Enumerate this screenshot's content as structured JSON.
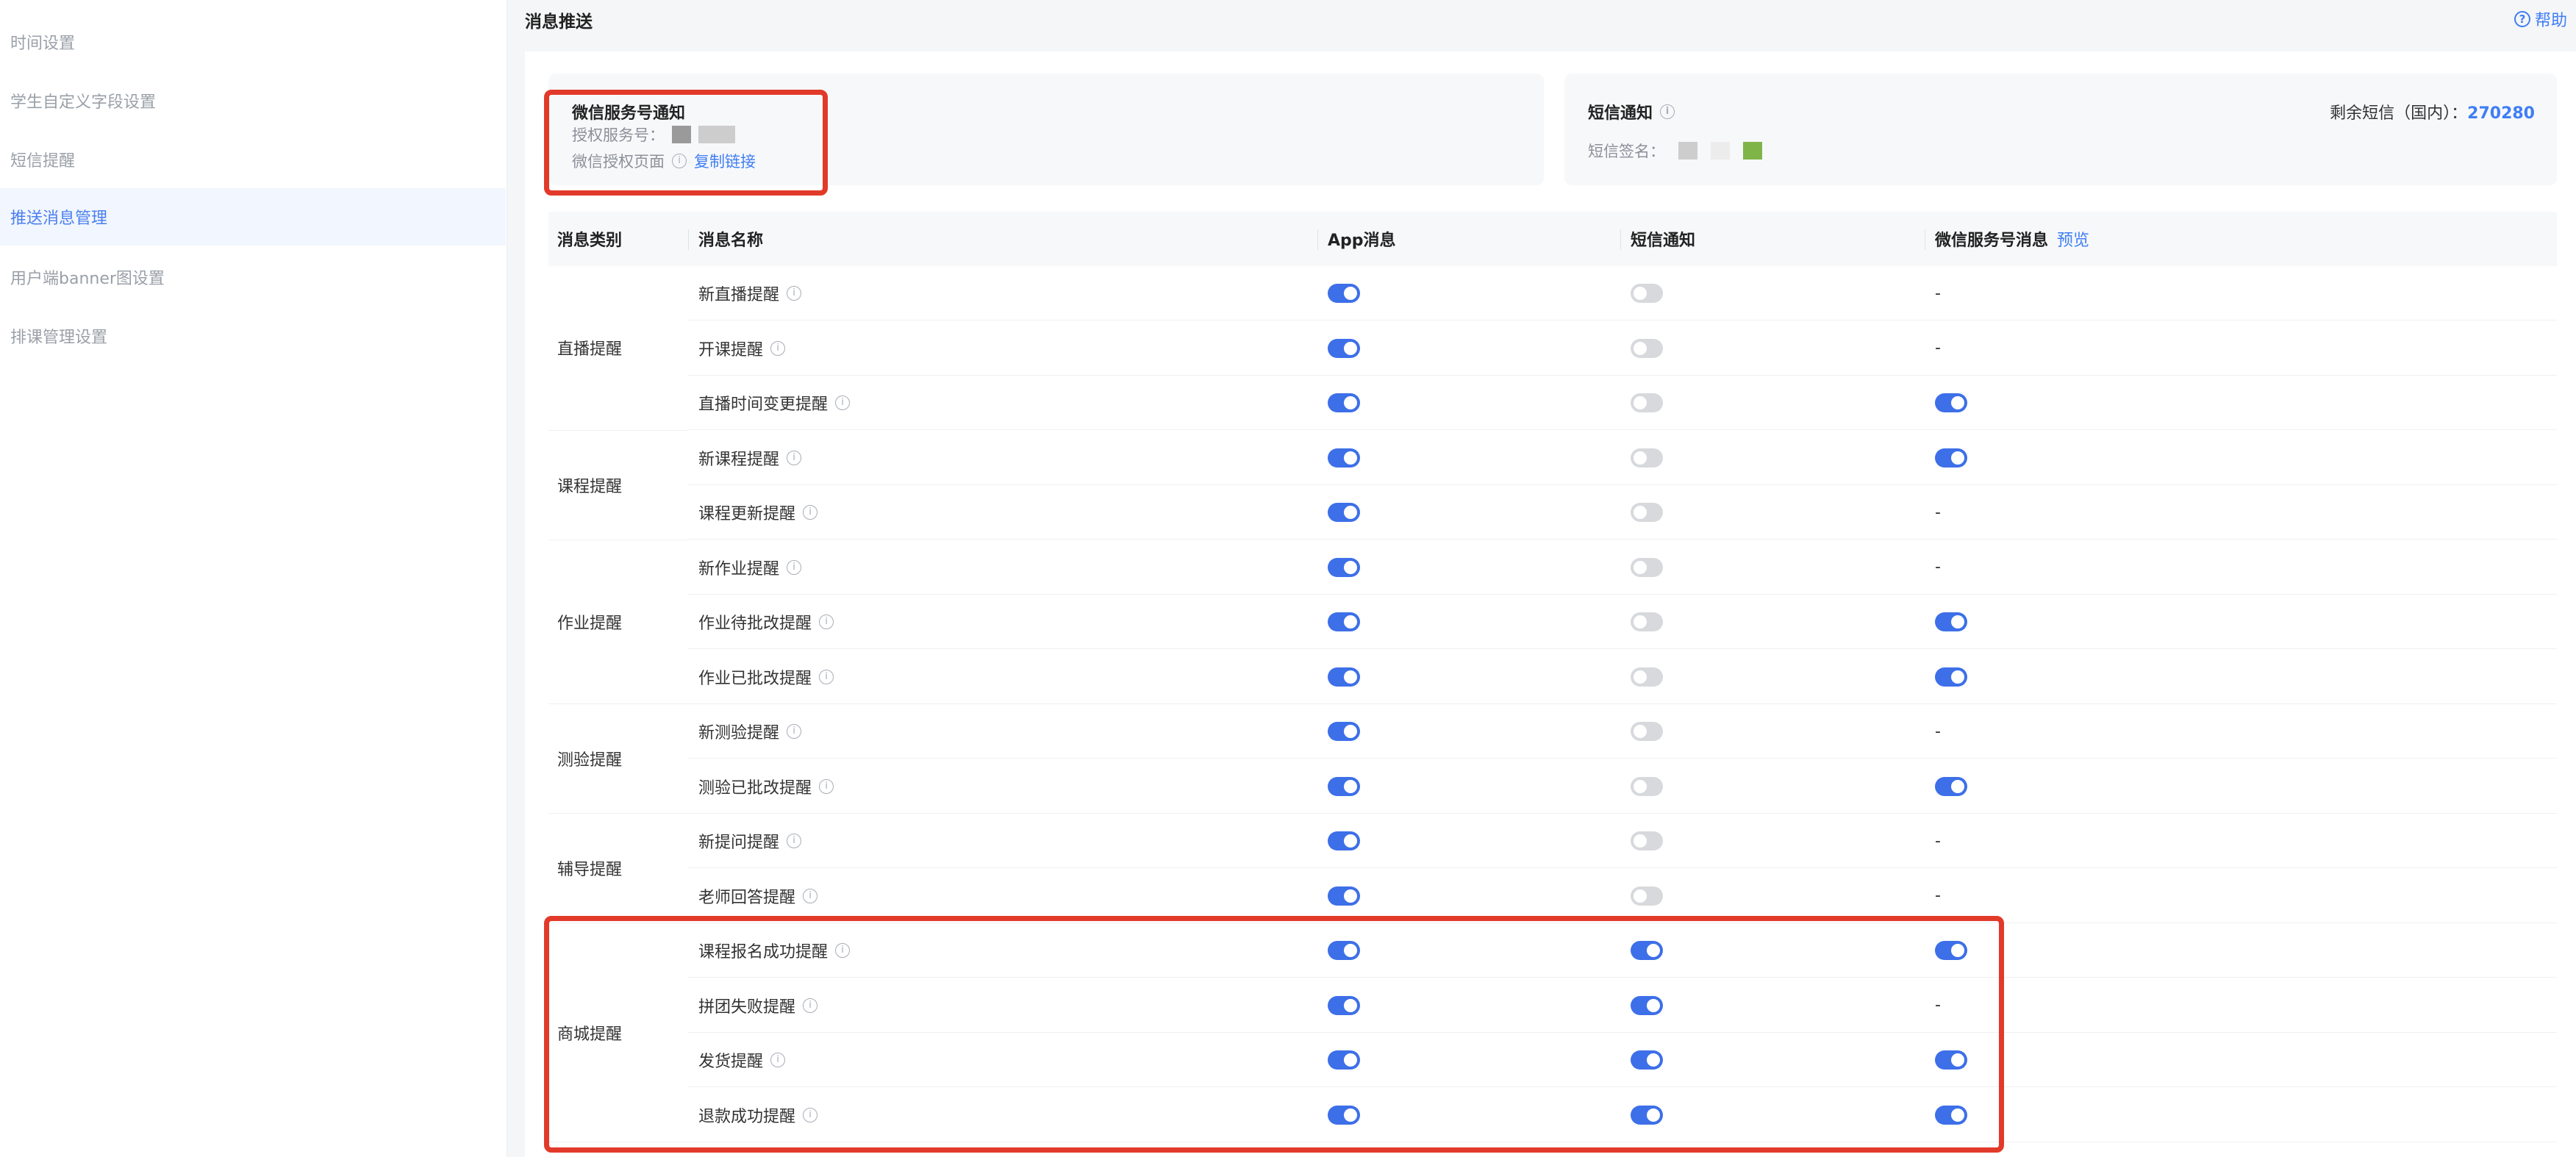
{
  "sidebar": {
    "items": [
      {
        "label": "时间设置",
        "active": false
      },
      {
        "label": "学生自定义字段设置",
        "active": false
      },
      {
        "label": "短信提醒",
        "active": false
      },
      {
        "label": "推送消息管理",
        "active": true
      },
      {
        "label": "用户端banner图设置",
        "active": false
      },
      {
        "label": "排课管理设置",
        "active": false
      }
    ]
  },
  "header": {
    "title": "消息推送",
    "help_label": "帮助"
  },
  "wechat_card": {
    "title": "微信服务号通知",
    "service_label": "授权服务号：",
    "auth_page_label": "微信授权页面",
    "copy_link": "复制链接"
  },
  "sms_card": {
    "title": "短信通知",
    "signature_label": "短信签名：",
    "remaining_label": "剩余短信（国内）：",
    "remaining_value": "270280"
  },
  "table": {
    "columns": {
      "category": "消息类别",
      "name": "消息名称",
      "app": "App消息",
      "sms": "短信通知",
      "wechat": "微信服务号消息",
      "preview": "预览"
    },
    "dash": "-",
    "groups": [
      {
        "category": "直播提醒",
        "rows": [
          {
            "name": "新直播提醒",
            "app": true,
            "sms": false,
            "wechat": null
          },
          {
            "name": "开课提醒",
            "app": true,
            "sms": false,
            "wechat": null
          },
          {
            "name": "直播时间变更提醒",
            "app": true,
            "sms": false,
            "wechat": true
          }
        ]
      },
      {
        "category": "课程提醒",
        "rows": [
          {
            "name": "新课程提醒",
            "app": true,
            "sms": false,
            "wechat": true
          },
          {
            "name": "课程更新提醒",
            "app": true,
            "sms": false,
            "wechat": null
          }
        ]
      },
      {
        "category": "作业提醒",
        "rows": [
          {
            "name": "新作业提醒",
            "app": true,
            "sms": false,
            "wechat": null
          },
          {
            "name": "作业待批改提醒",
            "app": true,
            "sms": false,
            "wechat": true
          },
          {
            "name": "作业已批改提醒",
            "app": true,
            "sms": false,
            "wechat": true
          }
        ]
      },
      {
        "category": "测验提醒",
        "rows": [
          {
            "name": "新测验提醒",
            "app": true,
            "sms": false,
            "wechat": null
          },
          {
            "name": "测验已批改提醒",
            "app": true,
            "sms": false,
            "wechat": true
          }
        ]
      },
      {
        "category": "辅导提醒",
        "rows": [
          {
            "name": "新提问提醒",
            "app": true,
            "sms": false,
            "wechat": null
          },
          {
            "name": "老师回答提醒",
            "app": true,
            "sms": false,
            "wechat": null
          }
        ]
      },
      {
        "category": "商城提醒",
        "rows": [
          {
            "name": "课程报名成功提醒",
            "app": true,
            "sms": true,
            "wechat": true
          },
          {
            "name": "拼团失败提醒",
            "app": true,
            "sms": true,
            "wechat": null
          },
          {
            "name": "发货提醒",
            "app": true,
            "sms": true,
            "wechat": true
          },
          {
            "name": "退款成功提醒",
            "app": true,
            "sms": true,
            "wechat": true
          }
        ]
      }
    ]
  },
  "colors": {
    "accent": "#3f7ef5",
    "switch_on": "#3d6fe8",
    "switch_off": "#d7d9dc",
    "highlight_box": "#e23a2a"
  }
}
